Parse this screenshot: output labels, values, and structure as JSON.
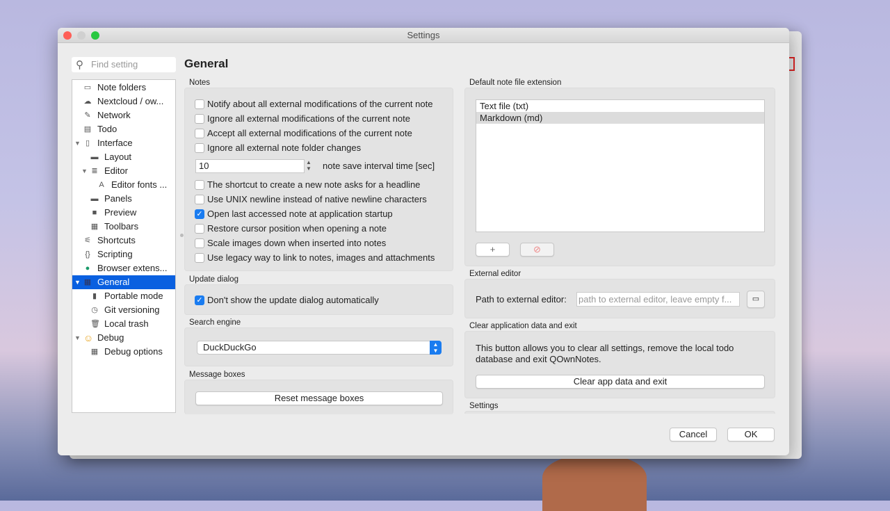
{
  "window": {
    "title": "Settings"
  },
  "search": {
    "placeholder": "Find setting"
  },
  "tree": [
    {
      "label": "Note folders",
      "icon": "folder-icon",
      "glyph": "▭",
      "indent": 0
    },
    {
      "label": "Nextcloud / ow...",
      "icon": "cloud-icon",
      "glyph": "☁",
      "indent": 0
    },
    {
      "label": "Network",
      "icon": "plug-icon",
      "glyph": "✎",
      "indent": 0
    },
    {
      "label": "Todo",
      "icon": "list-icon",
      "glyph": "▤",
      "indent": 0
    },
    {
      "label": "Interface",
      "icon": "interface-icon",
      "glyph": "▯",
      "indent": 0,
      "expanded": true
    },
    {
      "label": "Layout",
      "icon": "layout-icon",
      "glyph": "▬",
      "indent": 1
    },
    {
      "label": "Editor",
      "icon": "editor-icon",
      "glyph": "≣",
      "indent": 1,
      "expanded": true
    },
    {
      "label": "Editor fonts ...",
      "icon": "font-icon",
      "glyph": "A",
      "indent": 2
    },
    {
      "label": "Panels",
      "icon": "panels-icon",
      "glyph": "▬",
      "indent": 1
    },
    {
      "label": "Preview",
      "icon": "preview-icon",
      "glyph": "■",
      "indent": 1
    },
    {
      "label": "Toolbars",
      "icon": "toolbar-icon",
      "glyph": "▦",
      "indent": 1
    },
    {
      "label": "Shortcuts",
      "icon": "shortcuts-icon",
      "glyph": "⚟",
      "indent": 0
    },
    {
      "label": "Scripting",
      "icon": "braces-icon",
      "glyph": "{}",
      "indent": 0
    },
    {
      "label": "Browser extens...",
      "icon": "globe-icon",
      "glyph": "●",
      "indent": 0
    },
    {
      "label": "General",
      "icon": "general-icon",
      "glyph": "▦",
      "indent": 0,
      "expanded": true,
      "selected": true
    },
    {
      "label": "Portable mode",
      "icon": "usb-icon",
      "glyph": "▮",
      "indent": 1
    },
    {
      "label": "Git versioning",
      "icon": "clock-icon",
      "glyph": "◷",
      "indent": 1
    },
    {
      "label": "Local trash",
      "icon": "trash-icon",
      "glyph": "🗑",
      "indent": 1
    },
    {
      "label": "Debug",
      "icon": "smiley-icon",
      "glyph": "☺",
      "indent": 0,
      "expanded": true
    },
    {
      "label": "Debug options",
      "icon": "debug-options-icon",
      "glyph": "▦",
      "indent": 1
    }
  ],
  "page_title": "General",
  "notes": {
    "title": "Notes",
    "checks_a": [
      {
        "label": "Notify about all external modifications of the current note",
        "checked": false
      },
      {
        "label": "Ignore all external modifications of the current note",
        "checked": false
      },
      {
        "label": "Accept all external modifications of the current note",
        "checked": false
      },
      {
        "label": "Ignore all external note folder changes",
        "checked": false
      }
    ],
    "interval_value": "10",
    "interval_label": "note save interval time [sec]",
    "checks_b": [
      {
        "label": "The shortcut to create a new note asks for a headline",
        "checked": false
      },
      {
        "label": "Use UNIX newline instead of native newline characters",
        "checked": false
      },
      {
        "label": "Open last accessed note at application startup",
        "checked": true
      },
      {
        "label": "Restore cursor position when opening a note",
        "checked": false
      },
      {
        "label": "Scale images down when inserted into notes",
        "checked": false
      },
      {
        "label": "Use legacy way to link to notes, images and attachments",
        "checked": false
      }
    ]
  },
  "update": {
    "title": "Update dialog",
    "check": "Don't show the update dialog automatically"
  },
  "search_engine": {
    "title": "Search engine",
    "value": "DuckDuckGo"
  },
  "message_boxes": {
    "title": "Message boxes",
    "button": "Reset message boxes"
  },
  "extension": {
    "title": "Default note file extension",
    "items": [
      "Text file (txt)",
      "Markdown (md)"
    ],
    "add": "+",
    "remove": "⃠"
  },
  "external_editor": {
    "title": "External editor",
    "label": "Path to external editor:",
    "placeholder": "path to external editor, leave empty f..."
  },
  "clear": {
    "title": "Clear application data and exit",
    "text": "This button allows you to clear all settings, remove the local todo database and exit QOwnNotes.",
    "button": "Clear app data and exit"
  },
  "settings_group": {
    "title": "Settings"
  },
  "buttons": {
    "cancel": "Cancel",
    "ok": "OK"
  },
  "colors": {
    "accent": "#0a60e0",
    "checkbox": "#1a7cf0"
  }
}
